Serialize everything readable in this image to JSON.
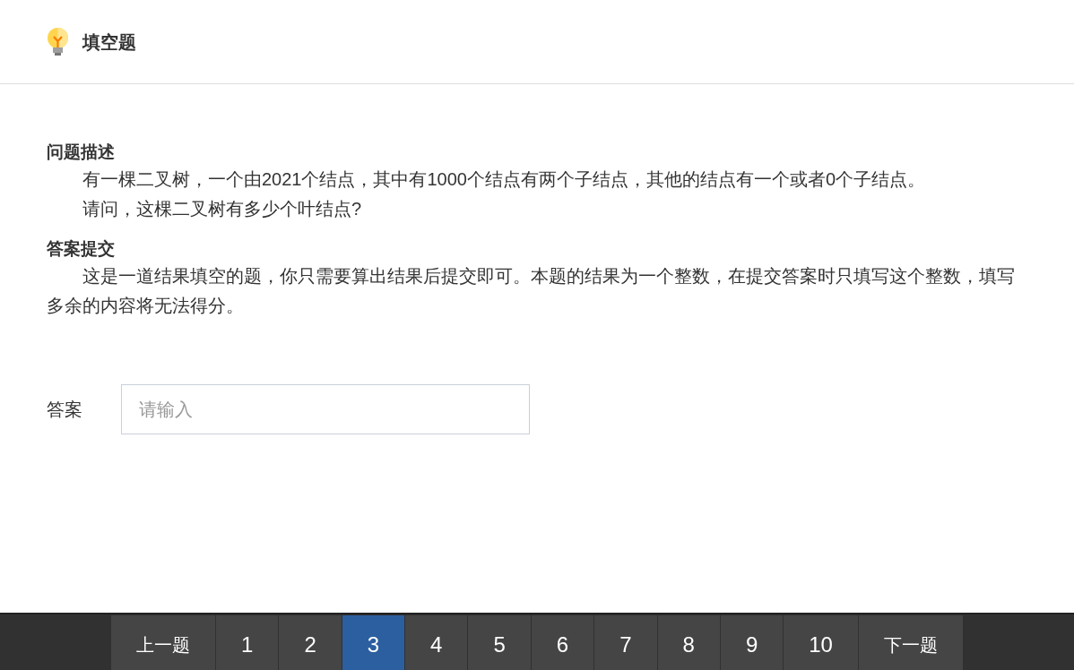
{
  "header": {
    "title": "填空题"
  },
  "sections": [
    {
      "heading": "问题描述",
      "paragraphs": [
        "有一棵二叉树，一个由2021个结点，其中有1000个结点有两个子结点，其他的结点有一个或者0个子结点。",
        "请问，这棵二叉树有多少个叶结点?"
      ]
    },
    {
      "heading": "答案提交",
      "paragraphs": [
        "这是一道结果填空的题，你只需要算出结果后提交即可。本题的结果为一个整数，在提交答案时只填写这个整数，填写多余的内容将无法得分。"
      ]
    }
  ],
  "answer": {
    "label": "答案",
    "placeholder": "请输入"
  },
  "pagination": [
    {
      "kind": "prev",
      "label": "上一题",
      "selected": false
    },
    {
      "kind": "page",
      "label": "1",
      "selected": false
    },
    {
      "kind": "page",
      "label": "2",
      "selected": false
    },
    {
      "kind": "page",
      "label": "3",
      "selected": true
    },
    {
      "kind": "page",
      "label": "4",
      "selected": false
    },
    {
      "kind": "page",
      "label": "5",
      "selected": false
    },
    {
      "kind": "page",
      "label": "6",
      "selected": false
    },
    {
      "kind": "page",
      "label": "7",
      "selected": false
    },
    {
      "kind": "page",
      "label": "8",
      "selected": false
    },
    {
      "kind": "page",
      "label": "9",
      "selected": false
    },
    {
      "kind": "page",
      "label": "10",
      "selected": false
    },
    {
      "kind": "next",
      "label": "下一题",
      "selected": false
    }
  ]
}
